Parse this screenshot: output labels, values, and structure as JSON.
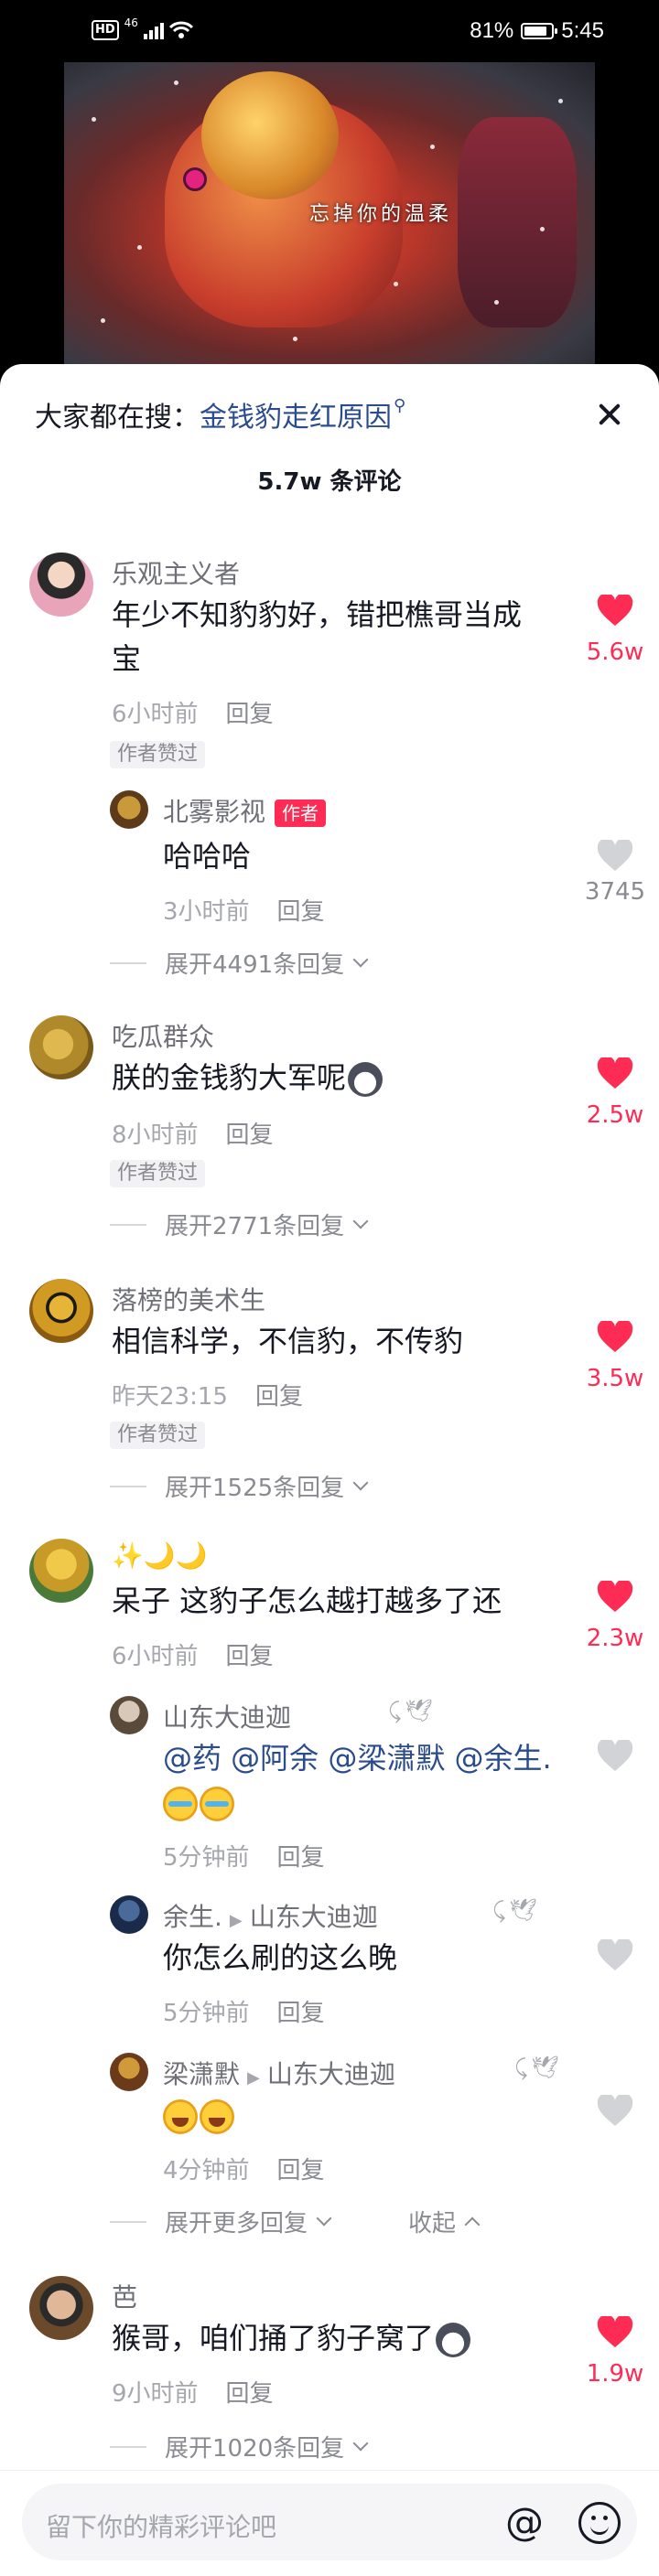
{
  "status_bar": {
    "network": "46",
    "battery": "81%",
    "time": "5:45"
  },
  "video": {
    "caption": "忘掉你的温柔"
  },
  "sheet": {
    "search_label": "大家都在搜：",
    "search_term": "金钱豹走红原因",
    "comment_count": "5.7w 条评论"
  },
  "comments": [
    {
      "user": "乐观主义者",
      "text_lines": [
        "年少不知豹豹好，错把樵哥当成",
        "宝"
      ],
      "time": "6小时前",
      "reply": "回复",
      "badge": "作者赞过",
      "likes": "5.6w",
      "replies": [
        {
          "user": "北雾影视",
          "author_tag": "作者",
          "text": "哈哈哈",
          "time": "3小时前",
          "reply": "回复",
          "likes": "3745"
        }
      ],
      "expand": "展开4491条回复"
    },
    {
      "user": "吃瓜群众",
      "text": "朕的金钱豹大军呢",
      "time": "8小时前",
      "reply": "回复",
      "badge": "作者赞过",
      "likes": "2.5w",
      "expand": "展开2771条回复"
    },
    {
      "user": "落榜的美术生",
      "text": "相信科学，不信豹，不传豹",
      "time": "昨天23:15",
      "reply": "回复",
      "badge": "作者赞过",
      "likes": "3.5w",
      "expand": "展开1525条回复"
    },
    {
      "user": "✨🌙🌙",
      "text": "呆子 这豹子怎么越打越多了还",
      "time": "6小时前",
      "reply": "回复",
      "likes": "2.3w",
      "replies": [
        {
          "user": "山东大迪迦",
          "text_line1": "@药 @阿余 @梁潇默 @余生.",
          "time": "5分钟前",
          "reply": "回复"
        },
        {
          "user": "余生.",
          "reply_to": "山东大迪迦",
          "text": "你怎么刷的这么晚",
          "time": "5分钟前",
          "reply": "回复"
        },
        {
          "user": "梁潇默",
          "reply_to": "山东大迪迦",
          "time": "4分钟前",
          "reply": "回复"
        }
      ],
      "expand": "展开更多回复",
      "collapse": "收起"
    },
    {
      "user": "芭",
      "text": "猴哥，咱们捅了豹子窝了",
      "time": "9小时前",
      "reply": "回复",
      "likes": "1.9w",
      "expand": "展开1020条回复"
    }
  ],
  "input": {
    "placeholder": "留下你的精彩评论吧",
    "at_label": "@"
  },
  "colors": {
    "like_red": "#fe2c55",
    "link_blue": "#2b4c8c",
    "muted": "#a5a7ad"
  },
  "icons": [
    "heart-icon",
    "search-icon",
    "close-icon",
    "at-icon",
    "emoji-icon",
    "chevron-down-icon",
    "chevron-up-icon"
  ]
}
